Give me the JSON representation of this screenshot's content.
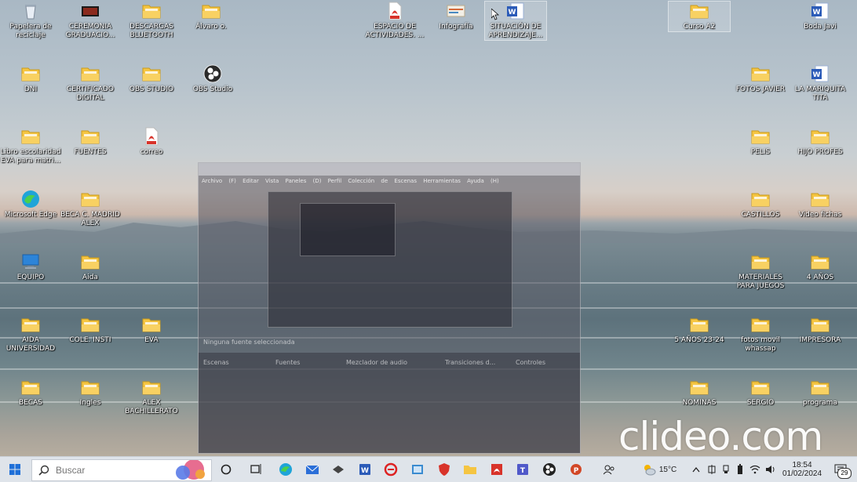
{
  "desktop_icons": [
    {
      "label": "Papelera de reciclaje",
      "icon": "recycle-bin-icon"
    },
    {
      "label": "CEREMONIA GRADUACIO...",
      "icon": "video-folder-icon"
    },
    {
      "label": "DESCARGAS BLUETOOTH",
      "icon": "folder-icon"
    },
    {
      "label": "Álvaro o.",
      "icon": "folder-icon"
    },
    {
      "label": "ESPACIO DE ACTIVIDADES. ...",
      "icon": "pdf-icon"
    },
    {
      "label": "Infografía",
      "icon": "image-icon"
    },
    {
      "label": "SITUACIÓN DE APRENDIZAJE...",
      "icon": "word-icon"
    },
    {
      "label": "Curso A2",
      "icon": "folder-icon"
    },
    {
      "label": "Boda Javi",
      "icon": "word-icon"
    },
    {
      "label": "DNI",
      "icon": "folder-icon"
    },
    {
      "label": "CERTIFICADO DIGITAL",
      "icon": "folder-icon"
    },
    {
      "label": "OBS STUDIO",
      "icon": "folder-icon"
    },
    {
      "label": "OBS Studio",
      "icon": "obs-icon"
    },
    {
      "label": "FOTOS JAVIER",
      "icon": "folder-icon"
    },
    {
      "label": "LA MARIQUITA TITA",
      "icon": "word-icon"
    },
    {
      "label": "Libro escolaridad EVA para matri...",
      "icon": "folder-icon"
    },
    {
      "label": "FUENTES",
      "icon": "folder-icon"
    },
    {
      "label": "correo",
      "icon": "pdf-icon"
    },
    {
      "label": "PELIS",
      "icon": "folder-icon"
    },
    {
      "label": "HIJO PROFES",
      "icon": "folder-icon"
    },
    {
      "label": "Microsoft Edge",
      "icon": "edge-icon"
    },
    {
      "label": "BECA C. MADRID ALEX",
      "icon": "folder-icon"
    },
    {
      "label": "CASTILLOS",
      "icon": "folder-icon"
    },
    {
      "label": "Video fichas",
      "icon": "folder-icon"
    },
    {
      "label": "EQUIPO",
      "icon": "computer-icon"
    },
    {
      "label": "Aida",
      "icon": "folder-icon"
    },
    {
      "label": "MATERIALES PARA JUEGOS",
      "icon": "folder-icon"
    },
    {
      "label": "4 AÑOS",
      "icon": "folder-icon"
    },
    {
      "label": "AIDA UNIVERSIDAD",
      "icon": "folder-icon"
    },
    {
      "label": "COLE. INSTI",
      "icon": "folder-icon"
    },
    {
      "label": "EVA",
      "icon": "folder-icon"
    },
    {
      "label": "5 AÑOS 23-24",
      "icon": "folder-icon"
    },
    {
      "label": "fotos movil whassap",
      "icon": "folder-icon"
    },
    {
      "label": "IMPRESORA",
      "icon": "folder-icon"
    },
    {
      "label": "BECAS",
      "icon": "folder-icon"
    },
    {
      "label": "Ingles",
      "icon": "folder-icon"
    },
    {
      "label": "ALEX BACHILLERATO",
      "icon": "folder-icon"
    },
    {
      "label": "NOMINAS",
      "icon": "folder-icon"
    },
    {
      "label": "SERGIO",
      "icon": "folder-icon"
    },
    {
      "label": "programa",
      "icon": "folder-icon"
    }
  ],
  "obs_ghost": {
    "menu": "Archivo (F)  Editar  Vista  Paneles (D)  Perfil  Colección de Escenas  Herramientas  Ayuda (H)",
    "docks": [
      "Escenas",
      "Fuentes",
      "Mezclador de audio",
      "Transiciones d...",
      "Controles"
    ],
    "no_source": "Ninguna fuente seleccionada"
  },
  "watermark": "clideo.com",
  "taskbar": {
    "search_placeholder": "Buscar",
    "temperature": "15°C",
    "time": "18:54",
    "date": "01/02/2024",
    "notification_count": "29"
  },
  "colors": {
    "taskbar_bg": "#dfe4ea",
    "folder": "#f5c542",
    "pdf": "#d8332a",
    "word": "#2b5bb8",
    "edge": "#1fa4d8"
  }
}
